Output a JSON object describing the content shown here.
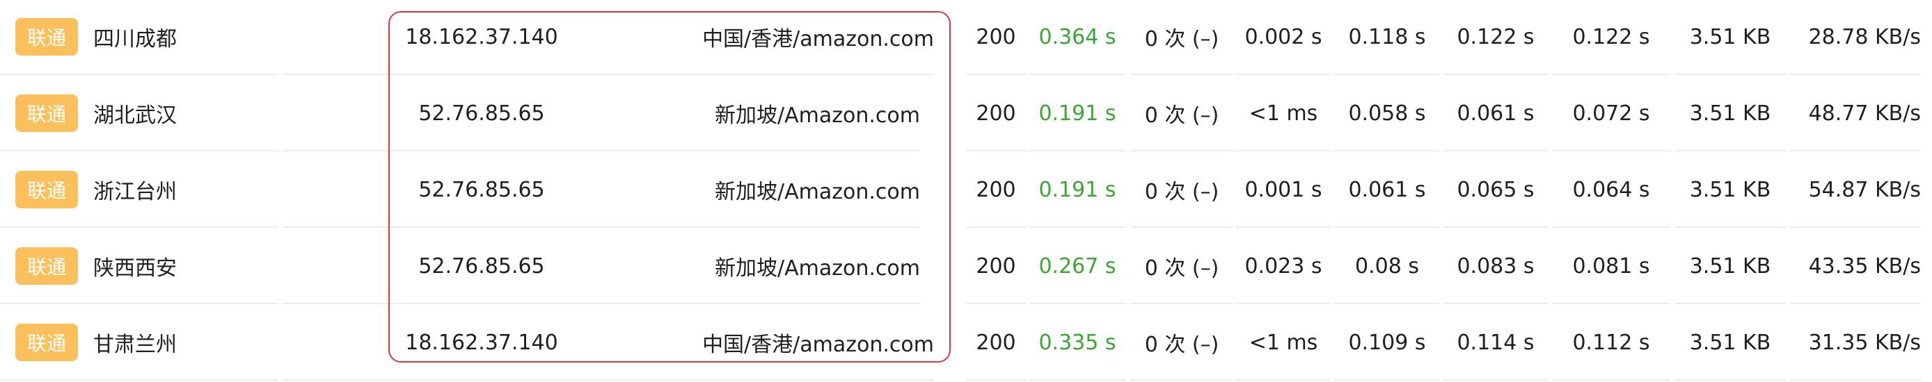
{
  "colors": {
    "isp_badge": "#fbbf5c",
    "fast_time": "#3aa734",
    "highlight_border": "#d9363e",
    "divider": "#ececec"
  },
  "rows": [
    {
      "isp": "联通",
      "node": "四川成都",
      "ip": "18.162.37.140",
      "location": "中国/香港/amazon.com",
      "status": "200",
      "total_time": "0.364 s",
      "redirects": "0 次 (–)",
      "dns_time": "0.002 s",
      "connect_time": "0.118 s",
      "download_time": "0.122 s",
      "first_byte_time": "0.122 s",
      "size": "3.51 KB",
      "speed": "28.78 KB/s"
    },
    {
      "isp": "联通",
      "node": "湖北武汉",
      "ip": "52.76.85.65",
      "location": "新加坡/Amazon.com",
      "status": "200",
      "total_time": "0.191 s",
      "redirects": "0 次 (–)",
      "dns_time": "<1 ms",
      "connect_time": "0.058 s",
      "download_time": "0.061 s",
      "first_byte_time": "0.072 s",
      "size": "3.51 KB",
      "speed": "48.77 KB/s"
    },
    {
      "isp": "联通",
      "node": "浙江台州",
      "ip": "52.76.85.65",
      "location": "新加坡/Amazon.com",
      "status": "200",
      "total_time": "0.191 s",
      "redirects": "0 次 (–)",
      "dns_time": "0.001 s",
      "connect_time": "0.061 s",
      "download_time": "0.065 s",
      "first_byte_time": "0.064 s",
      "size": "3.51 KB",
      "speed": "54.87 KB/s"
    },
    {
      "isp": "联通",
      "node": "陕西西安",
      "ip": "52.76.85.65",
      "location": "新加坡/Amazon.com",
      "status": "200",
      "total_time": "0.267 s",
      "redirects": "0 次 (–)",
      "dns_time": "0.023 s",
      "connect_time": "0.08 s",
      "download_time": "0.083 s",
      "first_byte_time": "0.081 s",
      "size": "3.51 KB",
      "speed": "43.35 KB/s"
    },
    {
      "isp": "联通",
      "node": "甘肃兰州",
      "ip": "18.162.37.140",
      "location": "中国/香港/amazon.com",
      "status": "200",
      "total_time": "0.335 s",
      "redirects": "0 次 (–)",
      "dns_time": "<1 ms",
      "connect_time": "0.109 s",
      "download_time": "0.114 s",
      "first_byte_time": "0.112 s",
      "size": "3.51 KB",
      "speed": "31.35 KB/s"
    }
  ]
}
